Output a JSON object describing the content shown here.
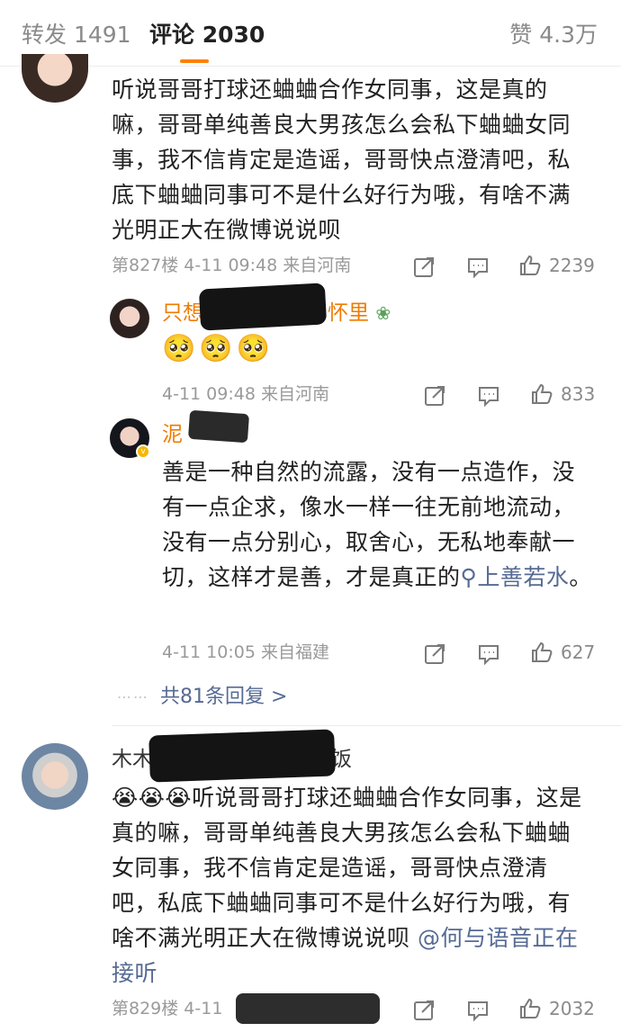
{
  "tabs": {
    "repost": "转发 1491",
    "comment": "评论 2030",
    "like": "赞 4.3万"
  },
  "comments": [
    {
      "text": "听说哥哥打球还蛐蛐合作女同事，这是真的嘛，哥哥单纯善良大男孩怎么会私下蛐蛐女同事，我不信肯定是造谣，哥哥快点澄清吧，私底下蛐蛐同事可不是什么好行为哦，有啥不满光明正大在微博说说呗",
      "meta": "第827楼 4-11 09:48 来自河南",
      "likes": "2239"
    },
    {
      "text_tail": "听说哥哥打球还蛐蛐合作女同事，这是真的嘛，哥哥单纯善良大男孩怎么会私下蛐蛐女同事，我不信肯定是造谣，哥哥快点澄清吧，私底下蛐蛐同事可不是什么好行为哦，有啥不满光明正大在微博说说呗 ",
      "emoji": "😭😭😭",
      "username": "木木",
      "username_tail": "饭",
      "mention": "@何与语音正在接听",
      "meta": "第829楼 4-11 ",
      "likes": "2032"
    }
  ],
  "replies": [
    {
      "username_prefix": "只想",
      "username_suffix": "怀里",
      "badge_icon": "lotus-icon",
      "emoji": "🥺🥺🥺",
      "meta": "4-11 09:48 来自河南",
      "likes": "833"
    },
    {
      "username_prefix": "泥",
      "text": "善是一种自然的流露，没有一点造作，没有一点企求，像水一样一往无前地流动，没有一点分别心，取舍心，无私地奉献一切，这样才是善，才是真正的",
      "topic_icon": "search-icon",
      "topic": "上善若水",
      "text_end": "。",
      "meta": "4-11 10:05 来自福建",
      "likes": "627"
    }
  ],
  "more_replies": {
    "dots": "⋯⋯",
    "label": "共81条回复 >"
  },
  "colors": {
    "accent": "#ff8200",
    "link": "#566b94",
    "username": "#f07b00",
    "meta": "#9a9a9a"
  }
}
